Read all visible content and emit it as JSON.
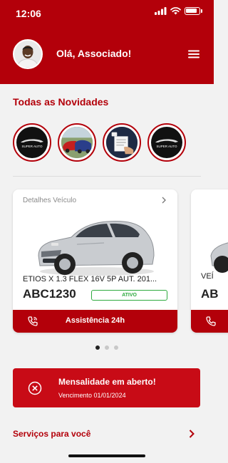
{
  "status_bar": {
    "time": "12:06"
  },
  "header": {
    "greeting": "Olá, Associado!",
    "menu_icon": "hamburger-menu-icon"
  },
  "news": {
    "title": "Todas as Novidades",
    "stories": [
      {
        "name": "super-auto-logo",
        "caption": "SUPER AUTO"
      },
      {
        "name": "cars-photo",
        "caption": ""
      },
      {
        "name": "document-handover-photo",
        "caption": ""
      },
      {
        "name": "super-auto-logo",
        "caption": "SUPER AUTO"
      }
    ]
  },
  "vehicle_cards": [
    {
      "label": "Detalhes Veículo",
      "model": "ETIOS X 1.3 FLEX 16V 5P AUT. 201...",
      "plate": "ABC1230",
      "status": "ATIVO",
      "assist_label": "Assistência 24h"
    },
    {
      "label": "VEÍ",
      "plate": "AB"
    }
  ],
  "carousel": {
    "pages": 3,
    "active": 0
  },
  "alert": {
    "title": "Mensalidade em aberto!",
    "subtitle": "Vencimento 01/01/2024"
  },
  "services": {
    "label": "Serviços para você"
  },
  "colors": {
    "primary": "#b3000a",
    "alert": "#c80b16",
    "active_green": "#2eaa3f"
  }
}
